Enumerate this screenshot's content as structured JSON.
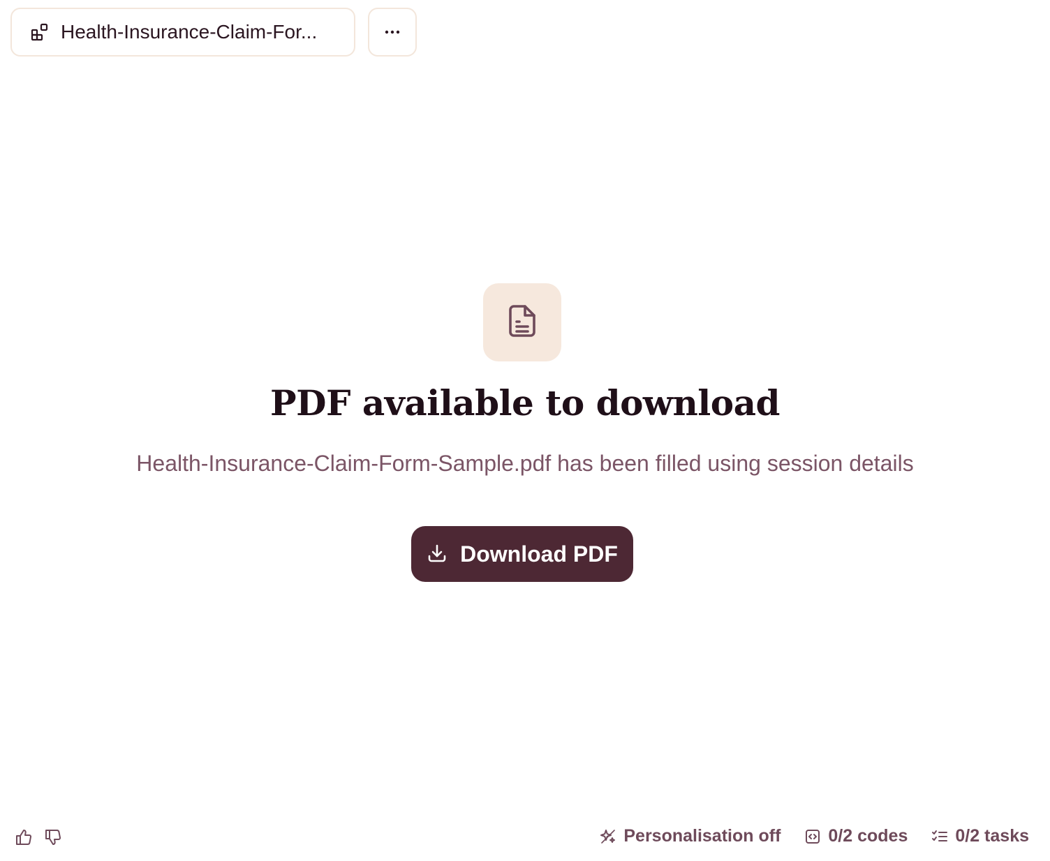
{
  "colors": {
    "accent": "#4d2834",
    "badge_bg": "#f6e8dd",
    "border": "#f3e6db",
    "muted_text": "#7b5566"
  },
  "header": {
    "doc_tab": {
      "icon": "apps-add-icon",
      "label": "Health-Insurance-Claim-For..."
    },
    "more_button": {
      "icon": "more-horizontal-icon"
    }
  },
  "main": {
    "icon": "file-text-icon",
    "title": "PDF available to download",
    "subtitle": "Health-Insurance-Claim-Form-Sample.pdf has been filled using session details",
    "download_button": {
      "icon": "download-icon",
      "label": "Download PDF"
    }
  },
  "footer": {
    "feedback": {
      "thumbs_up_icon": "thumbs-up-icon",
      "thumbs_down_icon": "thumbs-down-icon"
    },
    "status": [
      {
        "icon": "sparkle-icon",
        "label": "Personalisation off"
      },
      {
        "icon": "code-icon",
        "label": "0/2 codes"
      },
      {
        "icon": "checklist-icon",
        "label": "0/2 tasks"
      }
    ]
  }
}
